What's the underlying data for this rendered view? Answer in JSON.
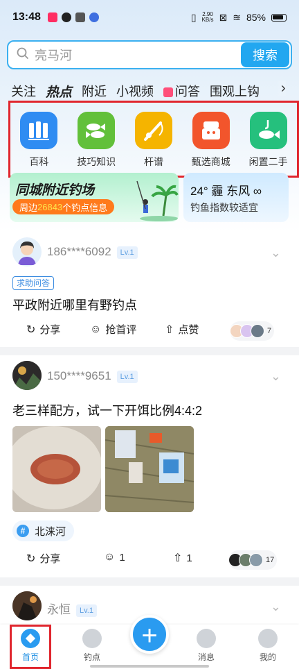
{
  "status": {
    "time": "13:48",
    "speed": "2.90",
    "speed_unit": "KB/s",
    "battery": "85%"
  },
  "search": {
    "placeholder": "亮马河",
    "button": "搜索"
  },
  "tabs": [
    "关注",
    "热点",
    "附近",
    "小视频",
    "问答",
    "围观上钩"
  ],
  "categories": [
    {
      "label": "百科",
      "icon": "encyclopedia-icon",
      "color": "#2f8cf2"
    },
    {
      "label": "技巧知识",
      "icon": "fish-tips-icon",
      "color": "#62c03a"
    },
    {
      "label": "杆谱",
      "icon": "rod-icon",
      "color": "#f5b400"
    },
    {
      "label": "甄选商城",
      "icon": "shop-icon",
      "color": "#f2552c"
    },
    {
      "label": "闲置二手",
      "icon": "secondhand-fish-icon",
      "color": "#25c07d"
    }
  ],
  "banner_local": {
    "title": "同城附近钓场",
    "sub_prefix": "周边",
    "count": "26843",
    "sub_suffix": "个钓点信息"
  },
  "banner_weather": {
    "line": "24° 霾 东风 ∞",
    "desc": "钓鱼指数较适宜"
  },
  "posts": [
    {
      "user": "186****6092",
      "level": "Lv.1",
      "tag": "求助问答",
      "title": "平政附近哪里有野钓点",
      "share": "分享",
      "comment": "抢首评",
      "like": "点赞",
      "likers": "7"
    },
    {
      "user": "150****9651",
      "level": "Lv.1",
      "title": "老三样配方，试一下开饵比例4:4:2",
      "topic": "北涞河",
      "share": "分享",
      "comment": "1",
      "like": "1",
      "likers": "17"
    },
    {
      "user": "永恒",
      "level": "Lv.1"
    }
  ],
  "nav": [
    {
      "label": "首页",
      "icon": "home-icon"
    },
    {
      "label": "钓点",
      "icon": "spot-icon"
    },
    {
      "label": "消息",
      "icon": "message-icon"
    },
    {
      "label": "我的",
      "icon": "profile-icon"
    }
  ]
}
